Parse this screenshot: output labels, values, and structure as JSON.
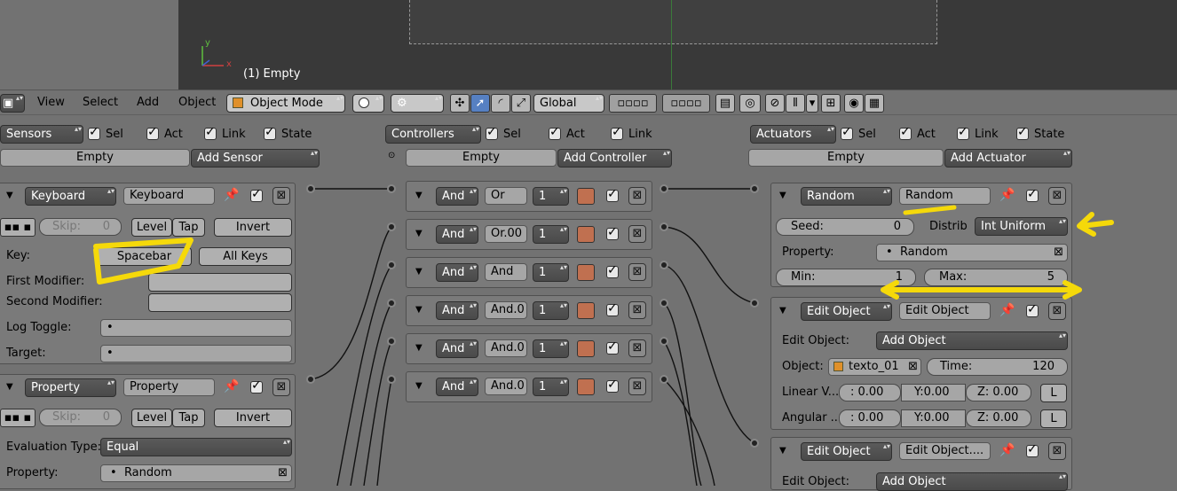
{
  "viewport": {
    "label": "(1) Empty",
    "axis_y": "y",
    "axis_x": "x"
  },
  "header": {
    "menus": [
      "View",
      "Select",
      "Add",
      "Object"
    ],
    "mode": "Object Mode",
    "orientation": "Global"
  },
  "sensors": {
    "filter": "Sensors",
    "sel": "Sel",
    "act": "Act",
    "link": "Link",
    "state": "State",
    "object": "Empty",
    "add": "Add Sensor",
    "keyboard": {
      "type": "Keyboard",
      "name": "Keyboard",
      "skip": "Skip:",
      "skip_val": "0",
      "level": "Level",
      "tap": "Tap",
      "invert": "Invert",
      "key_label": "Key:",
      "key_val": "Spacebar",
      "all_keys": "All Keys",
      "first_mod": "First Modifier:",
      "second_mod": "Second Modifier:",
      "log_toggle": "Log Toggle:",
      "target": "Target:"
    },
    "property": {
      "type": "Property",
      "name": "Property",
      "skip": "Skip:",
      "skip_val": "0",
      "level": "Level",
      "tap": "Tap",
      "invert": "Invert",
      "eval_label": "Evaluation Type:",
      "eval_val": "Equal",
      "prop_label": "Property:",
      "prop_val": "Random"
    }
  },
  "controllers": {
    "filter": "Controllers",
    "sel": "Sel",
    "act": "Act",
    "link": "Link",
    "object": "Empty",
    "add": "Add Controller",
    "rows": [
      {
        "type": "And",
        "name": "Or",
        "state": "1"
      },
      {
        "type": "And",
        "name": "Or.00",
        "state": "1"
      },
      {
        "type": "And",
        "name": "And",
        "state": "1"
      },
      {
        "type": "And",
        "name": "And.0",
        "state": "1"
      },
      {
        "type": "And",
        "name": "And.0",
        "state": "1"
      },
      {
        "type": "And",
        "name": "And.0",
        "state": "1"
      }
    ]
  },
  "actuators": {
    "filter": "Actuators",
    "sel": "Sel",
    "act": "Act",
    "link": "Link",
    "state": "State",
    "object": "Empty",
    "add": "Add Actuator",
    "random": {
      "type": "Random",
      "name": "Random",
      "seed_label": "Seed:",
      "seed_val": "0",
      "distrib": "Distrib",
      "distrib_val": "Int Uniform",
      "prop_label": "Property:",
      "prop_val": "Random",
      "min_label": "Min:",
      "min_val": "1",
      "max_label": "Max:",
      "max_val": "5"
    },
    "edit1": {
      "type": "Edit Object",
      "name": "Edit Object",
      "eo_label": "Edit Object:",
      "eo_val": "Add Object",
      "obj_label": "Object:",
      "obj_val": "texto_01",
      "time_label": "Time:",
      "time_val": "120",
      "linv": "Linear V...",
      "angv": "Angular ...",
      "lx": ": 0.00",
      "ly": "Y:0.00",
      "lz": "Z: 0.00",
      "ax": ": 0.00",
      "ay": "Y:0.00",
      "az": "Z: 0.00",
      "l": "L"
    },
    "edit2": {
      "type": "Edit Object",
      "name": "Edit Object....",
      "eo_label": "Edit Object:",
      "eo_val": "Add Object"
    }
  }
}
